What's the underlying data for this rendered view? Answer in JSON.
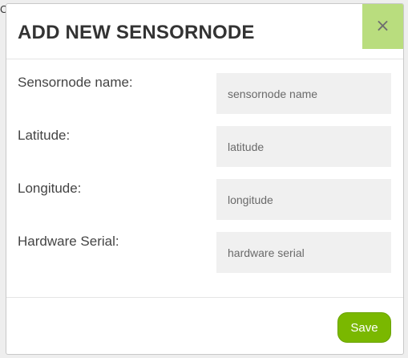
{
  "background": {
    "fragment_text": "C"
  },
  "modal": {
    "title": "ADD NEW SENSORNODE",
    "close_label": "×",
    "fields": [
      {
        "label": "Sensornode name:",
        "placeholder": "sensornode name",
        "value": ""
      },
      {
        "label": "Latitude:",
        "placeholder": "latitude",
        "value": ""
      },
      {
        "label": "Longitude:",
        "placeholder": "longitude",
        "value": ""
      },
      {
        "label": "Hardware Serial:",
        "placeholder": "hardware serial",
        "value": ""
      }
    ],
    "save_label": "Save"
  },
  "colors": {
    "accent": "#7ab800",
    "close_bg": "#b9dd7e",
    "input_bg": "#f0f0f0"
  }
}
